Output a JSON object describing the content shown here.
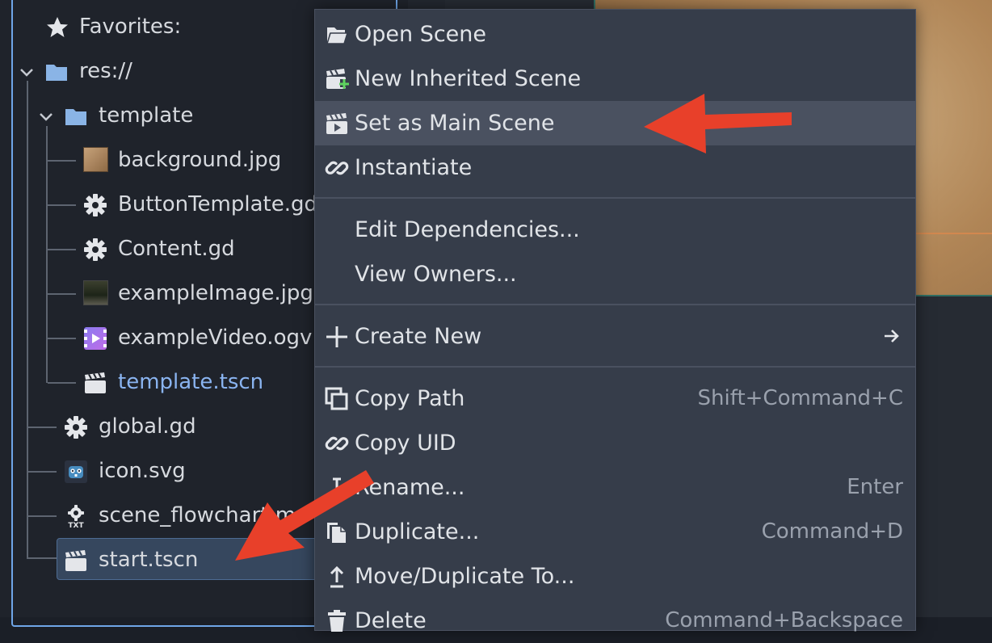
{
  "filesystem": {
    "favorites_label": "Favorites:",
    "root_label": "res://",
    "items": [
      {
        "label": "template"
      },
      {
        "label": "background.jpg"
      },
      {
        "label": "ButtonTemplate.gd"
      },
      {
        "label": "Content.gd"
      },
      {
        "label": "exampleImage.jpg"
      },
      {
        "label": "exampleVideo.ogv"
      },
      {
        "label": "template.tscn"
      },
      {
        "label": "global.gd"
      },
      {
        "label": "icon.svg"
      },
      {
        "label": "scene_flowchart.md"
      },
      {
        "label": "start.tscn"
      }
    ]
  },
  "menu": {
    "open_scene": "Open Scene",
    "new_inherited_scene": "New Inherited Scene",
    "set_as_main_scene": "Set as Main Scene",
    "instantiate": "Instantiate",
    "edit_dependencies": "Edit Dependencies...",
    "view_owners": "View Owners...",
    "create_new": "Create New",
    "copy_path": "Copy Path",
    "copy_path_shortcut": "Shift+Command+C",
    "copy_uid": "Copy UID",
    "rename": "Rename...",
    "rename_shortcut": "Enter",
    "duplicate": "Duplicate...",
    "duplicate_shortcut": "Command+D",
    "move_duplicate": "Move/Duplicate To...",
    "delete": "Delete",
    "delete_shortcut": "Command+Backspace"
  },
  "colors": {
    "accent": "#6fa6e8",
    "annotation_arrow": "#e8402a",
    "selected_file_text": "#8ab4f0",
    "folder": "#8ab4e6"
  }
}
